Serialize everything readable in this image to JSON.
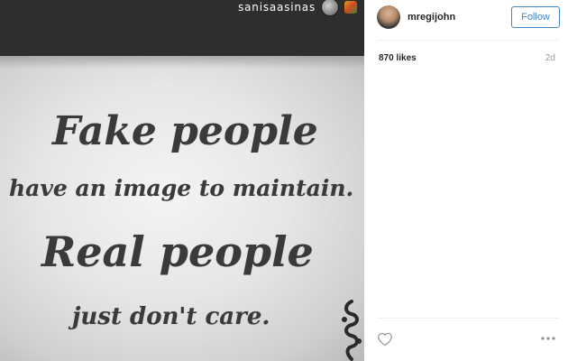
{
  "media": {
    "overlay_username": "sanisaasinas",
    "quote_lines": [
      "Fake people",
      "have an image to maintain.",
      "Real people",
      "just don't care."
    ]
  },
  "post": {
    "username": "mregijohn",
    "follow_label": "Follow",
    "likes": "870 likes",
    "time_ago": "2d"
  },
  "icons": {
    "like": "heart-icon",
    "more": "more-options-icon"
  },
  "colors": {
    "follow_accent": "#3f87c7",
    "topbar": "#2e2e2e"
  }
}
